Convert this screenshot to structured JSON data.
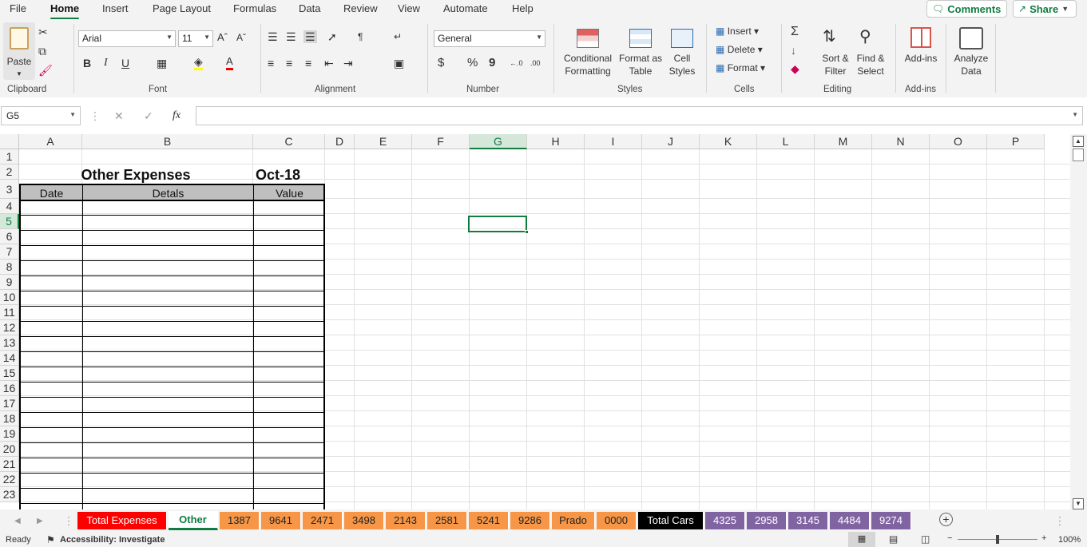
{
  "menu": {
    "tabs": [
      "File",
      "Home",
      "Insert",
      "Page Layout",
      "Formulas",
      "Data",
      "Review",
      "View",
      "Automate",
      "Help"
    ],
    "comments": "Comments",
    "share": "Share"
  },
  "ribbon": {
    "clipboard": {
      "paste": "Paste",
      "label": "Clipboard"
    },
    "font": {
      "family": "Arial",
      "size": "11",
      "bold": "B",
      "italic": "I",
      "underline": "U",
      "label": "Font"
    },
    "alignment": {
      "label": "Alignment"
    },
    "number": {
      "format": "General",
      "currency": "$",
      "percent": "%",
      "comma": "9",
      "label": "Number"
    },
    "styles": {
      "conditional": [
        "Conditional",
        "Formatting"
      ],
      "format_table": [
        "Format as",
        "Table"
      ],
      "cell_styles": [
        "Cell",
        "Styles"
      ],
      "label": "Styles"
    },
    "cells": {
      "insert": "Insert",
      "delete": "Delete",
      "format": "Format",
      "label": "Cells"
    },
    "editing": {
      "sort": [
        "Sort &",
        "Filter"
      ],
      "find": [
        "Find &",
        "Select"
      ],
      "label": "Editing"
    },
    "addins": {
      "button": "Add-ins",
      "label": "Add-ins"
    },
    "analyze": [
      "Analyze",
      "Data"
    ]
  },
  "formula_bar": {
    "name_box": "G5",
    "fx": "fx",
    "formula": ""
  },
  "grid": {
    "columns": [
      "A",
      "B",
      "C",
      "D",
      "E",
      "F",
      "G",
      "H",
      "I",
      "J",
      "K",
      "L",
      "M",
      "N",
      "O",
      "P"
    ],
    "rows": [
      "1",
      "2",
      "3",
      "4",
      "5",
      "6",
      "7",
      "8",
      "9",
      "10",
      "11",
      "12",
      "13",
      "14",
      "15",
      "16",
      "17",
      "18",
      "19",
      "20",
      "21",
      "22",
      "23"
    ],
    "selected_cell": "G5",
    "title": "Other Expenses",
    "period": "Oct-18",
    "headers": {
      "date": "Date",
      "details": "Detals",
      "value": "Value"
    }
  },
  "sheet_tabs": [
    {
      "name": "Total Expenses",
      "bg": "#ff0000",
      "fg": "#ffffff"
    },
    {
      "name": "Other",
      "bg": "#ffffff",
      "fg": "#107c41",
      "active": true
    },
    {
      "name": "1387",
      "bg": "#f79646",
      "fg": "#222222"
    },
    {
      "name": "9641",
      "bg": "#f79646",
      "fg": "#222222"
    },
    {
      "name": "2471",
      "bg": "#f79646",
      "fg": "#222222"
    },
    {
      "name": "3498",
      "bg": "#f79646",
      "fg": "#222222"
    },
    {
      "name": "2143",
      "bg": "#f79646",
      "fg": "#222222"
    },
    {
      "name": "2581",
      "bg": "#f79646",
      "fg": "#222222"
    },
    {
      "name": "5241",
      "bg": "#f79646",
      "fg": "#222222"
    },
    {
      "name": "9286",
      "bg": "#f79646",
      "fg": "#222222"
    },
    {
      "name": "Prado",
      "bg": "#f79646",
      "fg": "#222222"
    },
    {
      "name": "0000",
      "bg": "#f79646",
      "fg": "#222222"
    },
    {
      "name": "Total Cars",
      "bg": "#000000",
      "fg": "#ffffff"
    },
    {
      "name": "4325",
      "bg": "#8064a2",
      "fg": "#ffffff"
    },
    {
      "name": "2958",
      "bg": "#8064a2",
      "fg": "#ffffff"
    },
    {
      "name": "3145",
      "bg": "#8064a2",
      "fg": "#ffffff"
    },
    {
      "name": "4484",
      "bg": "#8064a2",
      "fg": "#ffffff"
    },
    {
      "name": "9274",
      "bg": "#8064a2",
      "fg": "#ffffff"
    }
  ],
  "status": {
    "ready": "Ready",
    "accessibility": "Accessibility: Investigate",
    "zoom": "100%"
  },
  "colors": {
    "accent": "#107c41",
    "selected_header": "#d4e7d9",
    "table_header": "#bfbfbf"
  }
}
